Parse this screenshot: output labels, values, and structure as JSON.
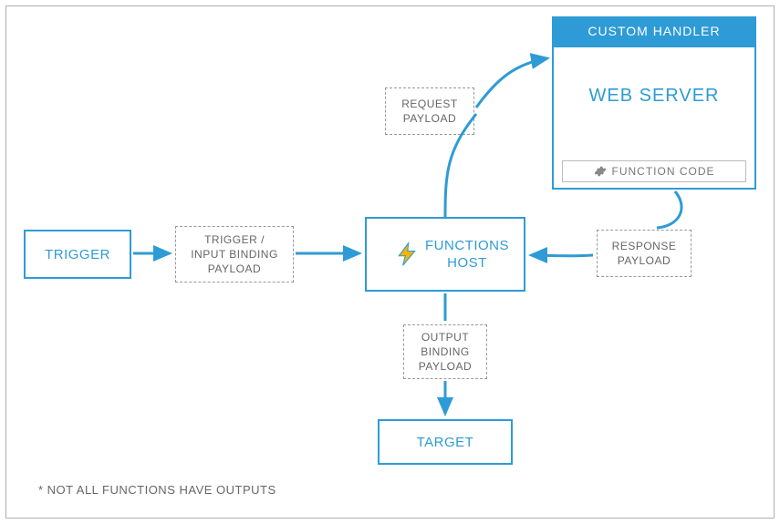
{
  "nodes": {
    "trigger": "TRIGGER",
    "input_payload": "TRIGGER /\nINPUT BINDING\nPAYLOAD",
    "functions_host": "FUNCTIONS\nHOST",
    "request_payload": "REQUEST\nPAYLOAD",
    "custom_handler_header": "CUSTOM HANDLER",
    "web_server": "WEB SERVER",
    "function_code": "FUNCTION CODE",
    "response_payload": "RESPONSE\nPAYLOAD",
    "output_payload": "OUTPUT\nBINDING\nPAYLOAD",
    "target": "TARGET"
  },
  "footnote": "* NOT ALL FUNCTIONS HAVE OUTPUTS",
  "colors": {
    "accent": "#2e9bd6",
    "dashed_border": "#999999",
    "text_muted": "#666666"
  },
  "edges": [
    {
      "from": "trigger",
      "to": "input_payload"
    },
    {
      "from": "input_payload",
      "to": "functions_host"
    },
    {
      "from": "functions_host",
      "via": "request_payload",
      "to": "web_server"
    },
    {
      "from": "web_server",
      "via": "response_payload",
      "to": "functions_host"
    },
    {
      "from": "functions_host",
      "via": "output_payload",
      "to": "target"
    }
  ]
}
